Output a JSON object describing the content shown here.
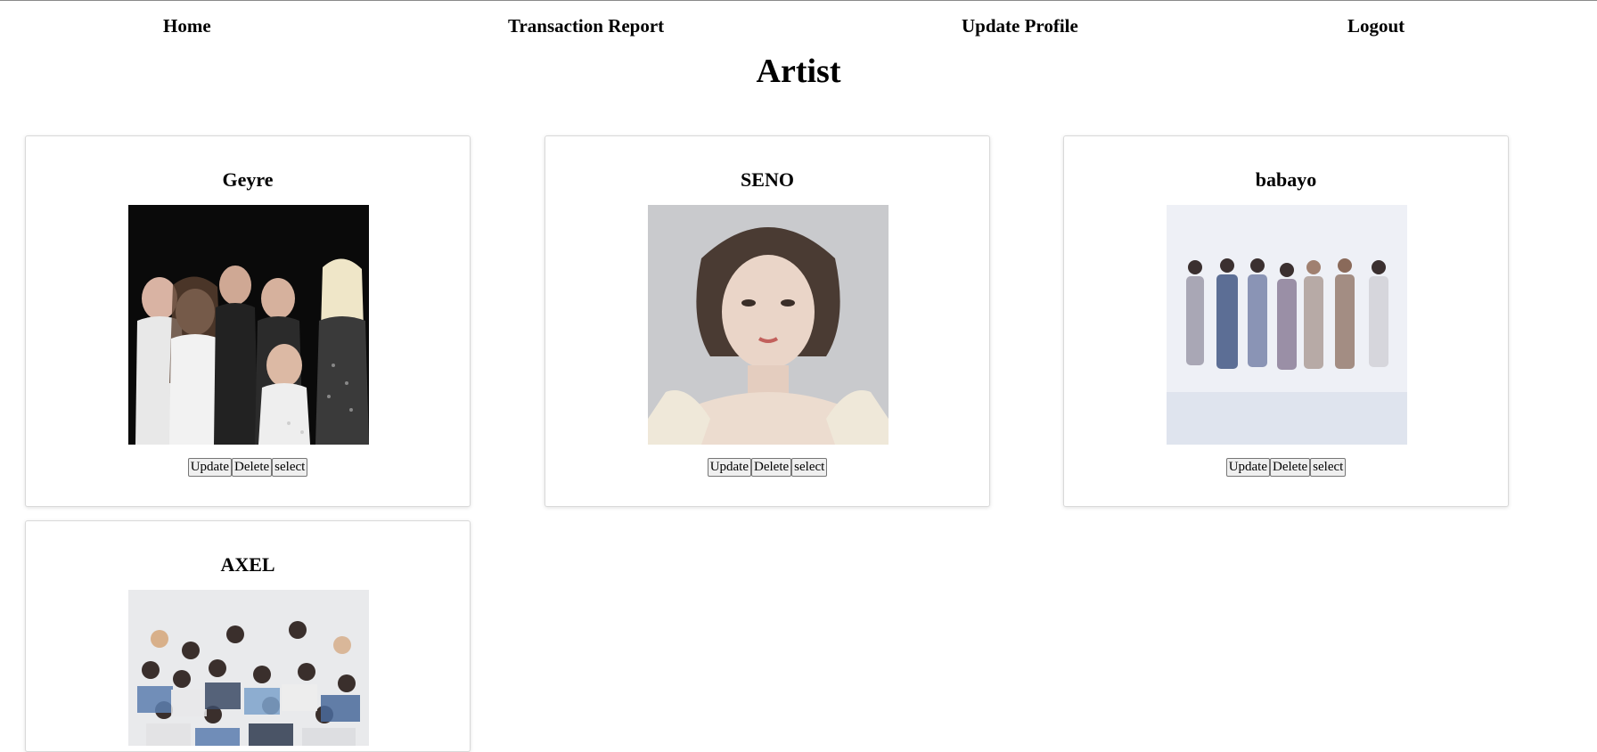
{
  "nav": {
    "home": "Home",
    "transaction_report": "Transaction Report",
    "update_profile": "Update Profile",
    "logout": "Logout"
  },
  "page": {
    "title": "Artist"
  },
  "artists": [
    {
      "name": "Geyre",
      "update_label": "Update",
      "delete_label": "Delete",
      "select_label": "select"
    },
    {
      "name": "SENO",
      "update_label": "Update",
      "delete_label": "Delete",
      "select_label": "select"
    },
    {
      "name": "babayo",
      "update_label": "Update",
      "delete_label": "Delete",
      "select_label": "select"
    },
    {
      "name": "AXEL"
    }
  ],
  "colors": {
    "card_border": "#d9d9d9",
    "button_bg": "#efefef",
    "button_border": "#767676"
  }
}
